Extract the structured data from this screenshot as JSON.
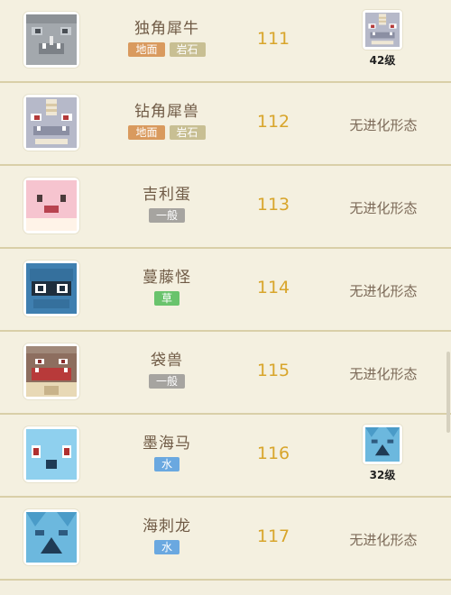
{
  "rows": [
    {
      "name": "独角犀牛",
      "types": [
        {
          "label": "地面",
          "color": "#d99a5e"
        },
        {
          "label": "岩石",
          "color": "#c8bf93"
        }
      ],
      "number": "111",
      "evolution": {
        "kind": "pokemon",
        "level": "42级",
        "icon": "rhydon-icon"
      },
      "icon": "rhyhorn-icon"
    },
    {
      "name": "钻角犀兽",
      "types": [
        {
          "label": "地面",
          "color": "#d99a5e"
        },
        {
          "label": "岩石",
          "color": "#c8bf93"
        }
      ],
      "number": "112",
      "evolution": {
        "kind": "none",
        "text": "无进化形态"
      },
      "icon": "rhydon-icon"
    },
    {
      "name": "吉利蛋",
      "types": [
        {
          "label": "一般",
          "color": "#a6a4a0"
        }
      ],
      "number": "113",
      "evolution": {
        "kind": "none",
        "text": "无进化形态"
      },
      "icon": "chansey-icon"
    },
    {
      "name": "蔓藤怪",
      "types": [
        {
          "label": "草",
          "color": "#69c36c"
        }
      ],
      "number": "114",
      "evolution": {
        "kind": "none",
        "text": "无进化形态"
      },
      "icon": "tangela-icon"
    },
    {
      "name": "袋兽",
      "types": [
        {
          "label": "一般",
          "color": "#a6a4a0"
        }
      ],
      "number": "115",
      "evolution": {
        "kind": "none",
        "text": "无进化形态"
      },
      "icon": "kangaskhan-icon"
    },
    {
      "name": "墨海马",
      "types": [
        {
          "label": "水",
          "color": "#6aa8e0"
        }
      ],
      "number": "116",
      "evolution": {
        "kind": "pokemon",
        "level": "32级",
        "icon": "seadra-icon"
      },
      "icon": "horsea-icon"
    },
    {
      "name": "海刺龙",
      "types": [
        {
          "label": "水",
          "color": "#6aa8e0"
        }
      ],
      "number": "117",
      "evolution": {
        "kind": "none",
        "text": "无进化形态"
      },
      "icon": "seadra-icon"
    }
  ]
}
